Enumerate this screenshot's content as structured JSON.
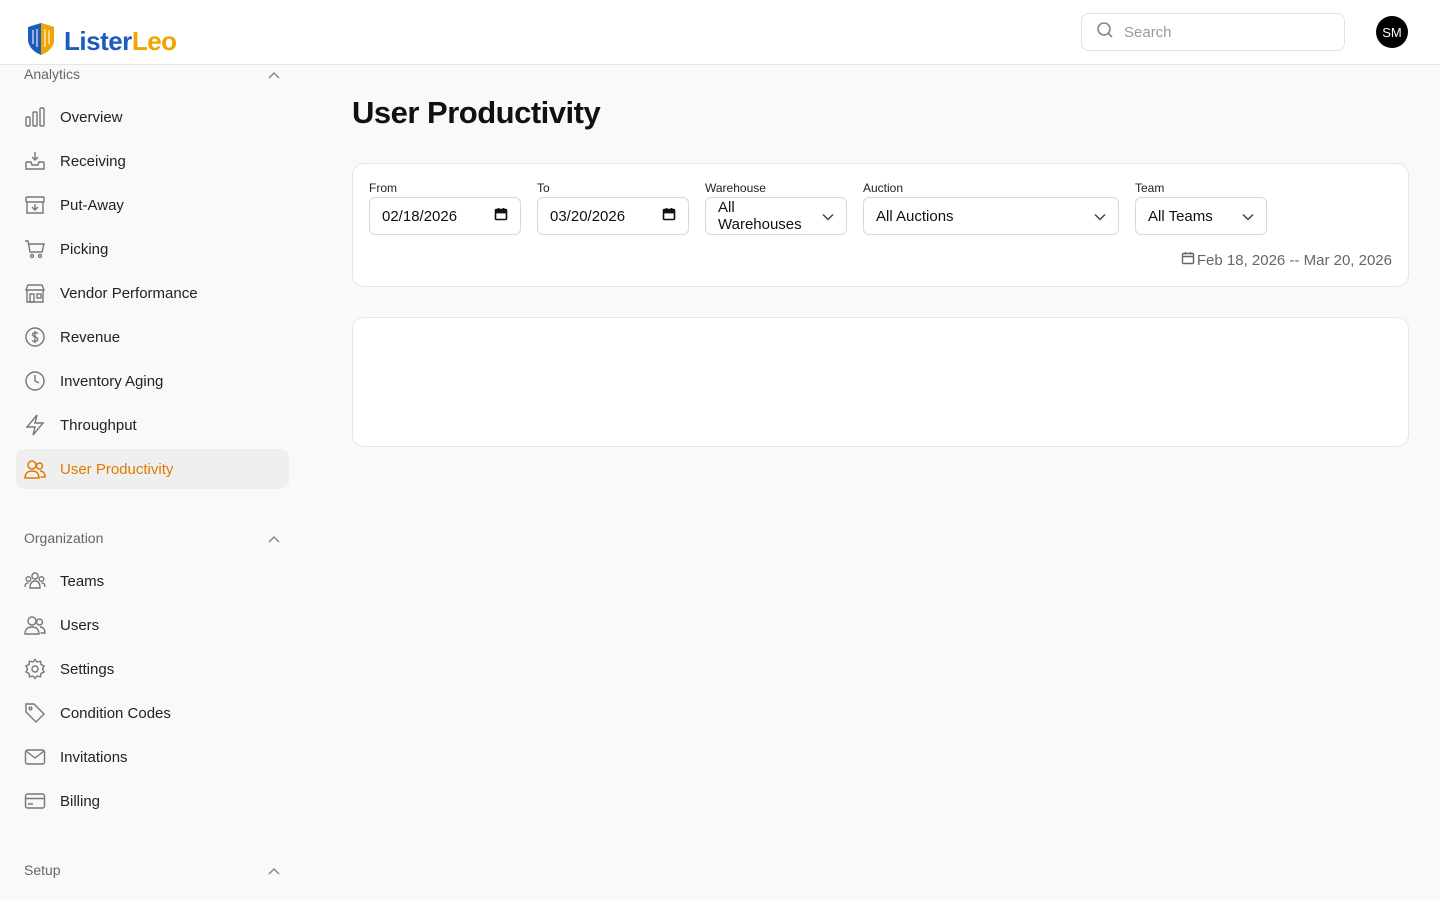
{
  "brand": {
    "name_part1": "Lister",
    "name_part2": "Leo"
  },
  "header": {
    "search_placeholder": "Search",
    "avatar_initials": "SM"
  },
  "sidebar": {
    "analytics": {
      "title": "Analytics",
      "items": [
        {
          "label": "Overview",
          "icon": "bar-chart-icon"
        },
        {
          "label": "Receiving",
          "icon": "inbox-download-icon"
        },
        {
          "label": "Put-Away",
          "icon": "archive-icon"
        },
        {
          "label": "Picking",
          "icon": "cart-icon"
        },
        {
          "label": "Vendor Performance",
          "icon": "store-icon"
        },
        {
          "label": "Revenue",
          "icon": "dollar-circle-icon"
        },
        {
          "label": "Inventory Aging",
          "icon": "clock-icon"
        },
        {
          "label": "Throughput",
          "icon": "bolt-icon"
        },
        {
          "label": "User Productivity",
          "icon": "users-icon",
          "active": true
        }
      ]
    },
    "organization": {
      "title": "Organization",
      "items": [
        {
          "label": "Teams",
          "icon": "team-icon"
        },
        {
          "label": "Users",
          "icon": "users-icon"
        },
        {
          "label": "Settings",
          "icon": "gear-icon"
        },
        {
          "label": "Condition Codes",
          "icon": "tag-icon"
        },
        {
          "label": "Invitations",
          "icon": "mail-icon"
        },
        {
          "label": "Billing",
          "icon": "credit-card-icon"
        }
      ]
    },
    "setup": {
      "title": "Setup"
    }
  },
  "page": {
    "title": "User Productivity",
    "filters": {
      "from": {
        "label": "From",
        "value": "02/18/2026"
      },
      "to": {
        "label": "To",
        "value": "03/20/2026"
      },
      "warehouse": {
        "label": "Warehouse",
        "value": "All Warehouses"
      },
      "auction": {
        "label": "Auction",
        "value": "All Auctions"
      },
      "team": {
        "label": "Team",
        "value": "All Teams"
      }
    },
    "date_range": "Feb 18, 2026 -- Mar 20, 2026"
  },
  "colors": {
    "accent": "#e07b00",
    "brand_blue": "#1e5bbf",
    "brand_gold": "#f0a500"
  }
}
